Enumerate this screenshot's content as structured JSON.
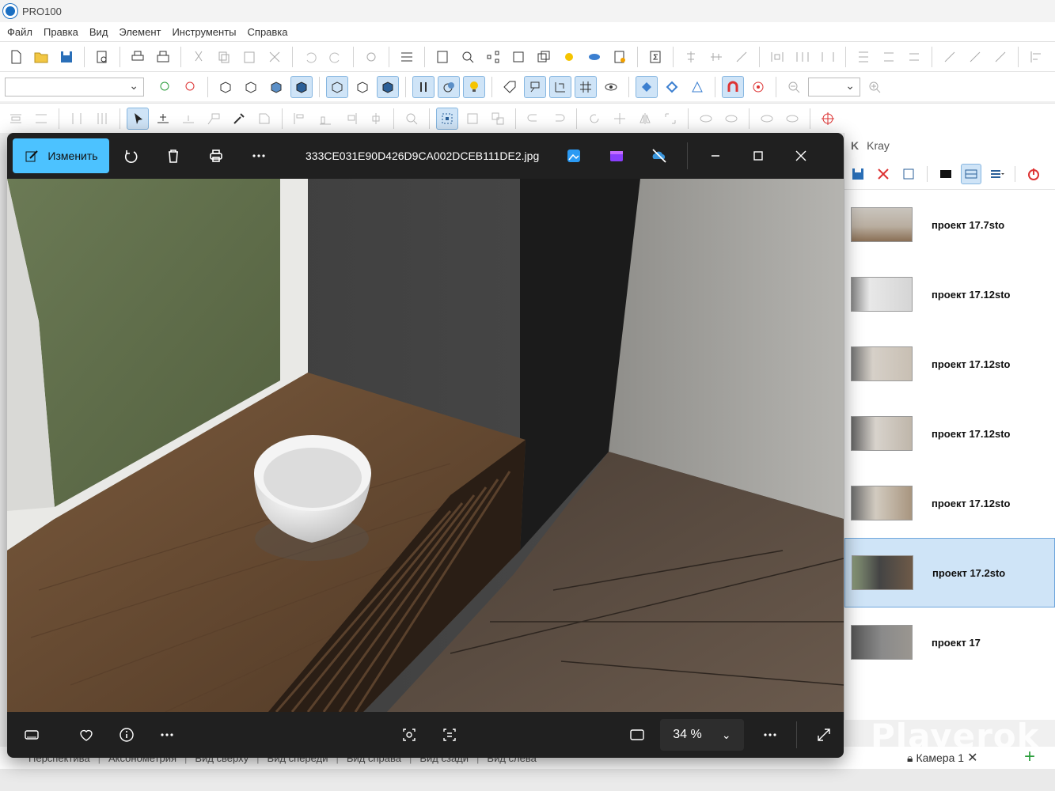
{
  "app": {
    "title": "PRO100"
  },
  "menu": [
    "Файл",
    "Правка",
    "Вид",
    "Элемент",
    "Инструменты",
    "Справка"
  ],
  "viewer": {
    "edit_label": "Изменить",
    "filename": "333CE031E90D426D9CA002DCEB111DE2.jpg",
    "zoom": "34 %"
  },
  "kray": {
    "title": "Kray",
    "items": [
      {
        "label": "проект 17.7sto",
        "selected": false
      },
      {
        "label": "проект 17.12sto",
        "selected": false
      },
      {
        "label": "проект 17.12sto",
        "selected": false
      },
      {
        "label": "проект 17.12sto",
        "selected": false
      },
      {
        "label": "проект 17.12sto",
        "selected": false
      },
      {
        "label": "проект 17.2sto",
        "selected": true
      },
      {
        "label": "проект 17",
        "selected": false
      }
    ]
  },
  "view_tabs": [
    "Перспектива",
    "Аксонометрия",
    "Вид сверху",
    "Вид спереди",
    "Вид справа",
    "Вид сзади",
    "Вид слева"
  ],
  "camera_tab": "Камера 1",
  "watermark": "Playerok",
  "colors": {
    "accent": "#4cc2ff",
    "selection": "#cfe4f7",
    "viewer_bg": "#202020"
  }
}
